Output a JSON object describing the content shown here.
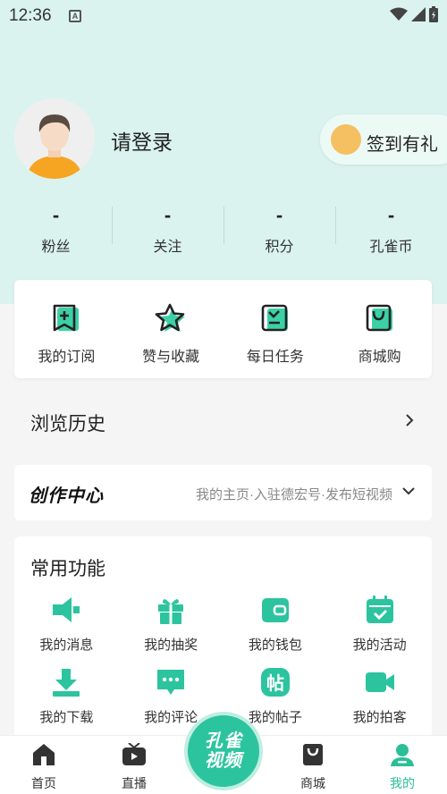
{
  "status_bar": {
    "time": "12:36",
    "badge": "A"
  },
  "profile": {
    "login_label": "请登录",
    "checkin_label": "签到有礼"
  },
  "stats": [
    {
      "value": "-",
      "label": "粉丝"
    },
    {
      "value": "-",
      "label": "关注"
    },
    {
      "value": "-",
      "label": "积分"
    },
    {
      "value": "-",
      "label": "孔雀币"
    }
  ],
  "quick_actions": [
    {
      "label": "我的订阅",
      "icon": "bookmark-plus-icon"
    },
    {
      "label": "赞与收藏",
      "icon": "star-icon"
    },
    {
      "label": "每日任务",
      "icon": "task-icon"
    },
    {
      "label": "商城购",
      "icon": "shopping-bag-icon"
    }
  ],
  "history": {
    "title": "浏览历史"
  },
  "creator": {
    "logo": "创作中心",
    "desc": "我的主页·入驻德宏号·发布短视频"
  },
  "functions": {
    "title": "常用功能",
    "items": [
      {
        "label": "我的消息",
        "icon": "message-icon"
      },
      {
        "label": "我的抽奖",
        "icon": "gift-icon"
      },
      {
        "label": "我的钱包",
        "icon": "wallet-icon"
      },
      {
        "label": "我的活动",
        "icon": "calendar-check-icon"
      },
      {
        "label": "我的下载",
        "icon": "download-icon"
      },
      {
        "label": "我的评论",
        "icon": "comment-icon"
      },
      {
        "label": "我的帖子",
        "icon": "post-icon"
      },
      {
        "label": "我的拍客",
        "icon": "video-camera-icon"
      }
    ]
  },
  "center_button": {
    "line1": "孔雀",
    "line2": "视频"
  },
  "tabs": [
    {
      "label": "首页",
      "icon": "home-icon"
    },
    {
      "label": "直播",
      "icon": "tv-icon"
    },
    {
      "label": "商城",
      "icon": "shopping-bag-icon"
    },
    {
      "label": "我的",
      "icon": "person-icon",
      "active": true
    }
  ],
  "colors": {
    "accent": "#2bbf98",
    "hero_bg": "#daf3ee"
  }
}
